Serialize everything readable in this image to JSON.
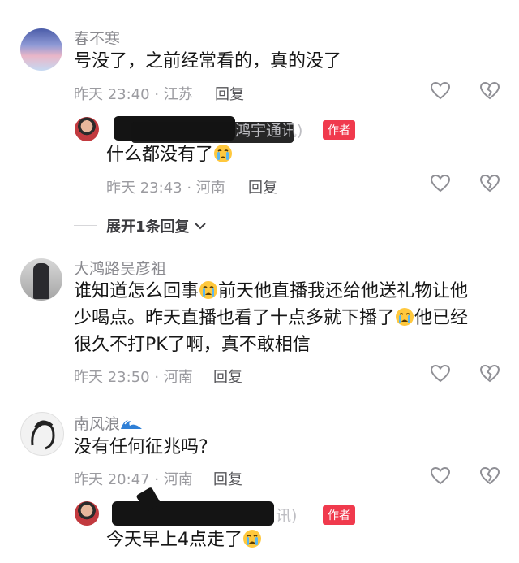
{
  "comments": [
    {
      "user": "春不寒",
      "text": "号没了，之前经常看的，真的没了",
      "time": "昨天 23:40 · 江苏",
      "reply": "回复",
      "sub": {
        "user_partial": "鸿宇通讯)",
        "tag": "作者",
        "text": "什么都没有了",
        "time": "昨天 23:43 · 河南",
        "reply": "回复"
      },
      "expand": "展开1条回复"
    },
    {
      "user": "大鸿路吴彦祖",
      "line1a": "谁知道怎么回事",
      "line1b": "前天他直播我还给他送礼物让他",
      "line2a": "少喝点。昨天直播也看了十点多就下播了",
      "line2b": "他已经",
      "line3": "很久不打PK了啊，真不敢相信",
      "time": "昨天 23:50 · 河南",
      "reply": "回复"
    },
    {
      "user": "南风浪",
      "text": "没有任何征兆吗?",
      "time": "昨天 20:47 · 河南",
      "reply": "回复",
      "sub": {
        "user_partial": "讯)",
        "tag": "作者",
        "text": "今天早上4点走了"
      }
    }
  ],
  "colors": {
    "tag": "#f03a4d",
    "text": "#161616",
    "meta": "#9b9ba0"
  },
  "icons": [
    "heart-icon",
    "broken-heart-icon",
    "crying-emoji",
    "wave-emoji",
    "chevron-down-icon"
  ]
}
